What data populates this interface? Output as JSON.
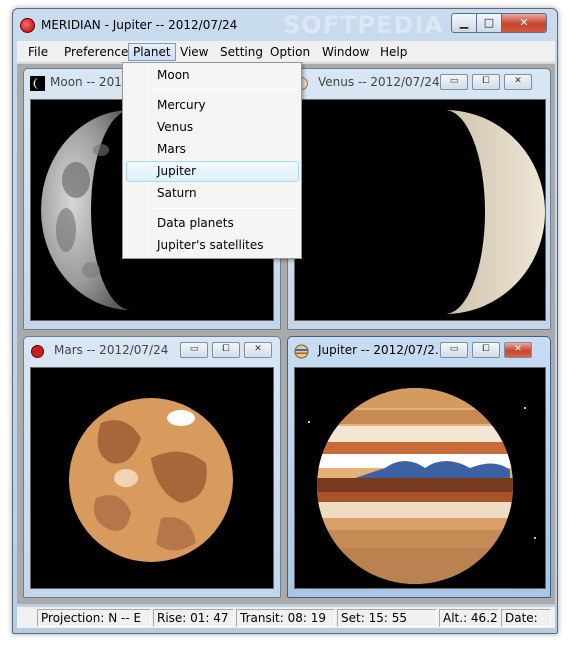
{
  "window": {
    "title": "MERIDIAN -  Jupiter -- 2012/07/24",
    "watermark": "SOFTPEDIA",
    "minimize_glyph": "▁",
    "maximize_glyph": "□",
    "close_glyph": "✕"
  },
  "menubar": {
    "items": [
      "File",
      "Preference",
      "Planet",
      "View",
      "Setting",
      "Option",
      "Window",
      "Help"
    ],
    "active": "Planet"
  },
  "planet_menu": {
    "items": [
      "Moon",
      "Mercury",
      "Venus",
      "Mars",
      "Jupiter",
      "Saturn",
      "Data planets",
      "Jupiter's satellites"
    ],
    "highlighted": "Jupiter"
  },
  "child_windows": [
    {
      "title": "Moon -- 2012/07/24",
      "icon": "moon-icon"
    },
    {
      "title": "Venus -- 2012/07/24",
      "icon": "venus-icon"
    },
    {
      "title": "Mars -- 2012/07/24",
      "icon": "mars-icon"
    },
    {
      "title": "Jupiter -- 2012/07/2...",
      "icon": "jupiter-icon",
      "active": true
    }
  ],
  "child_buttons": {
    "minimize": "▭",
    "maximize": "⧠",
    "close": "✕"
  },
  "statusbar": {
    "projection": "Projection: N -- E",
    "rise": "Rise: 01: 47",
    "transit": "Transit: 08: 19",
    "set": "Set: 15: 55",
    "alt": "Alt.: 46.25",
    "date": "Date:"
  },
  "colors": {
    "title_close_red": "#c5432c",
    "mdi_background": "#aaaaaa",
    "menu_highlight": "#dcf0fb"
  }
}
